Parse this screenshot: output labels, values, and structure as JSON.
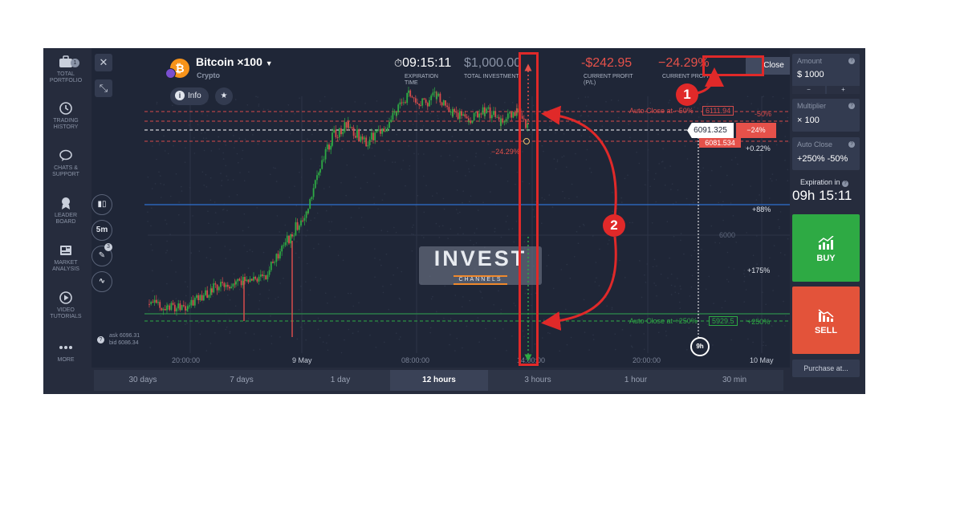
{
  "sidebar": {
    "items": [
      {
        "label_1": "TOTAL",
        "label_2": "PORTFOLIO",
        "icon": "briefcase-icon",
        "badge": "1"
      },
      {
        "label_1": "TRADING",
        "label_2": "HISTORY",
        "icon": "history-icon"
      },
      {
        "label_1": "CHATS &",
        "label_2": "SUPPORT",
        "icon": "chat-icon"
      },
      {
        "label_1": "LEADER",
        "label_2": "BOARD",
        "icon": "trophy-icon"
      },
      {
        "label_1": "MARKET",
        "label_2": "ANALYSIS",
        "icon": "newspaper-icon"
      },
      {
        "label_1": "VIDEO",
        "label_2": "TUTORIALS",
        "icon": "play-icon"
      },
      {
        "label_1": "MORE",
        "label_2": "",
        "icon": "more-icon"
      }
    ]
  },
  "header": {
    "asset_name": "Bitcoin ×100",
    "asset_symbol": "₿",
    "asset_category": "Crypto",
    "info_label": "Info",
    "expiration_time": "09:15:11",
    "expiration_label_1": "EXPIRATION",
    "expiration_label_2": "TIME",
    "total_investment": "$1,000.00",
    "total_investment_label": "TOTAL INVESTMENT",
    "current_profit": "-$242.95",
    "current_profit_label_1": "CURRENT PROFIT",
    "current_profit_label_2": "(P/L)",
    "current_profit_pct": "−24.29%",
    "current_profit_pct_label": "CURRENT PROFIT %",
    "close_label": "Close"
  },
  "chart": {
    "timeframe_label": "5m",
    "tool_badge": "3",
    "ask": "ask 6096.31",
    "bid": "bid 6086.34",
    "auto_close_top": "Auto Close at −50%",
    "auto_close_top_value": "6111.94",
    "auto_close_bottom": "Auto Close at +250%",
    "auto_close_bottom_value": "5929.5",
    "current_price": "6091.325",
    "current_pct": "−24%",
    "entry_price": "6081.534",
    "pct_labels": [
      "-50%",
      "+0.22%",
      "+88%",
      "+175%",
      "+250%"
    ],
    "trade_pl_label": "−24.29%",
    "price_tick": "6000",
    "expiry_marker": "9h",
    "x_ticks": [
      "20:00:00",
      "9 May",
      "08:00:00",
      "14:00:00",
      "20:00:00",
      "10 May"
    ],
    "watermark_1": "INVEST",
    "watermark_2": "CHANNELS"
  },
  "timeframes": [
    "30 days",
    "7 days",
    "1 day",
    "12 hours",
    "3 hours",
    "1 hour",
    "30 min"
  ],
  "active_timeframe": "12 hours",
  "right_panel": {
    "amount_label": "Amount",
    "amount_value": "$ 1000",
    "minus": "−",
    "plus": "+",
    "multiplier_label": "Multiplier",
    "multiplier_value": "× 100",
    "auto_close_label": "Auto Close",
    "auto_close_value": "+250% -50%",
    "expiration_label": "Expiration in",
    "expiration_value": "09h 15:11",
    "buy_label": "BUY",
    "sell_label": "SELL",
    "purchase_label": "Purchase at..."
  },
  "annotations": {
    "one": "1",
    "two": "2"
  },
  "colors": {
    "accent_red": "#e02929",
    "buy_green": "#2eaa44",
    "sell_red": "#e3533a",
    "background": "#262c3d"
  }
}
